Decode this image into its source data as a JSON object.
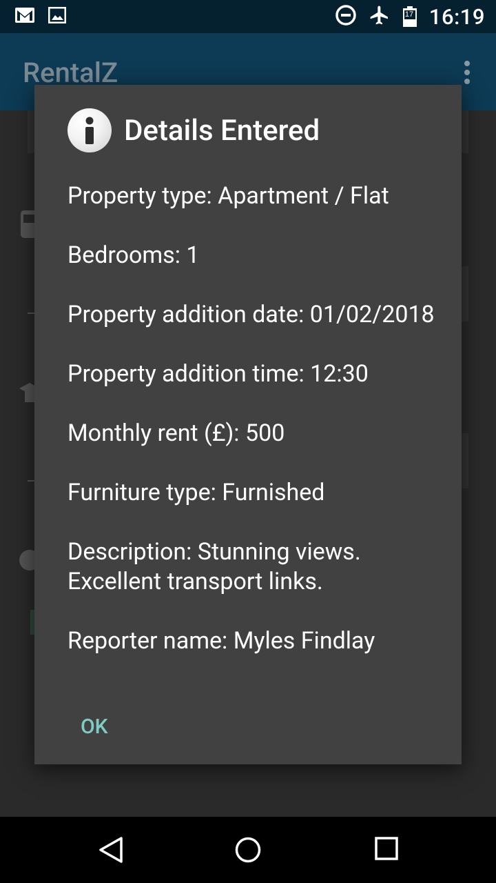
{
  "status_bar": {
    "time": "16:19",
    "left_icons": [
      "gmail-icon",
      "gallery-icon"
    ],
    "right_icons": [
      "do-not-disturb-icon",
      "airplane-icon",
      "calendar-icon"
    ],
    "calendar_day": "17"
  },
  "app_bar": {
    "title": "RentalZ",
    "menu_icon": "overflow-menu-icon"
  },
  "dialog": {
    "icon": "info-icon",
    "title": "Details Entered",
    "lines": [
      "Property type: Apartment / Flat",
      "Bedrooms: 1",
      "Property addition date: 01/02/2018",
      "Property addition time: 12:30",
      "Monthly rent (£): 500",
      "Furniture type: Furnished",
      "Description: Stunning views. Excellent transport links.",
      "Reporter name: Myles Findlay"
    ],
    "ok_label": "OK"
  },
  "nav_bar": {
    "back_icon": "back-icon",
    "home_icon": "home-icon",
    "recents_icon": "recents-icon"
  },
  "colors": {
    "status_bar": "#05202f",
    "app_bar": "#0d3a54",
    "dialog_bg": "#414141",
    "accent": "#80cbc4"
  }
}
